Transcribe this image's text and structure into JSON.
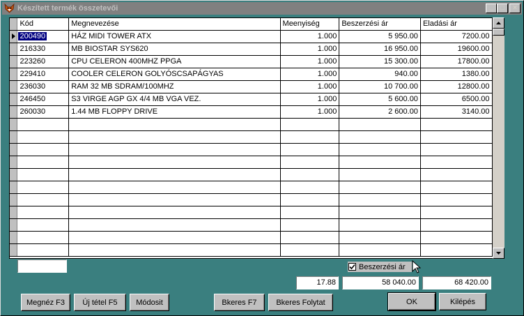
{
  "window": {
    "title": "Készített termék összetevői",
    "controls": {
      "minimize": "_",
      "maximize": "□",
      "close": "×"
    }
  },
  "grid": {
    "columns": [
      "Kód",
      "Megnevezése",
      "Meenyiség",
      "Beszerzési ár",
      "Eladási ár"
    ],
    "rows": [
      {
        "kod": "200490",
        "nev": "HÁZ MIDI TOWER ATX",
        "menny": "1.000",
        "beszerzes": "5 950.00",
        "eladas": "7200.00"
      },
      {
        "kod": "216330",
        "nev": "MB BIOSTAR SYS620",
        "menny": "1.000",
        "beszerzes": "16 950.00",
        "eladas": "19600.00"
      },
      {
        "kod": "223260",
        "nev": "CPU CELERON 400MHZ PPGA",
        "menny": "1.000",
        "beszerzes": "15 300.00",
        "eladas": "17800.00"
      },
      {
        "kod": "229410",
        "nev": "COOLER CELERON GOLYÓSCSAPÁGYAS",
        "menny": "1.000",
        "beszerzes": "940.00",
        "eladas": "1380.00"
      },
      {
        "kod": "236030",
        "nev": "RAM 32 MB SDRAM/100MHZ",
        "menny": "1.000",
        "beszerzes": "10 700.00",
        "eladas": "12800.00"
      },
      {
        "kod": "246450",
        "nev": "S3 VIRGE AGP GX 4/4 MB VGA VEZ.",
        "menny": "1.000",
        "beszerzes": "5 600.00",
        "eladas": "6500.00"
      },
      {
        "kod": "260030",
        "nev": "1.44 MB FLOPPY DRIVE",
        "menny": "1.000",
        "beszerzes": "2 600.00",
        "eladas": "3140.00"
      }
    ],
    "selected_row": 0
  },
  "checkbox": {
    "label": "Beszerzési ár",
    "checked": true
  },
  "totals": {
    "left_blank": "",
    "quantity": "17.88",
    "purchase": "58 040.00",
    "sale": "68 420.00"
  },
  "buttons": {
    "megnez": "Megnéz F3",
    "uj_tetel": "Új tétel F5",
    "modosit": "Módosit",
    "bkeres": "Bkeres F7",
    "bkeres_folytat": "Bkeres Folytat",
    "ok": "OK",
    "kilepes": "Kilépés"
  },
  "colors": {
    "background": "#3a7f7f",
    "titlebar": "#808080",
    "selection": "#000080"
  },
  "icons": {
    "app": "fox-icon",
    "row_indicator": "triangle-right-icon"
  }
}
